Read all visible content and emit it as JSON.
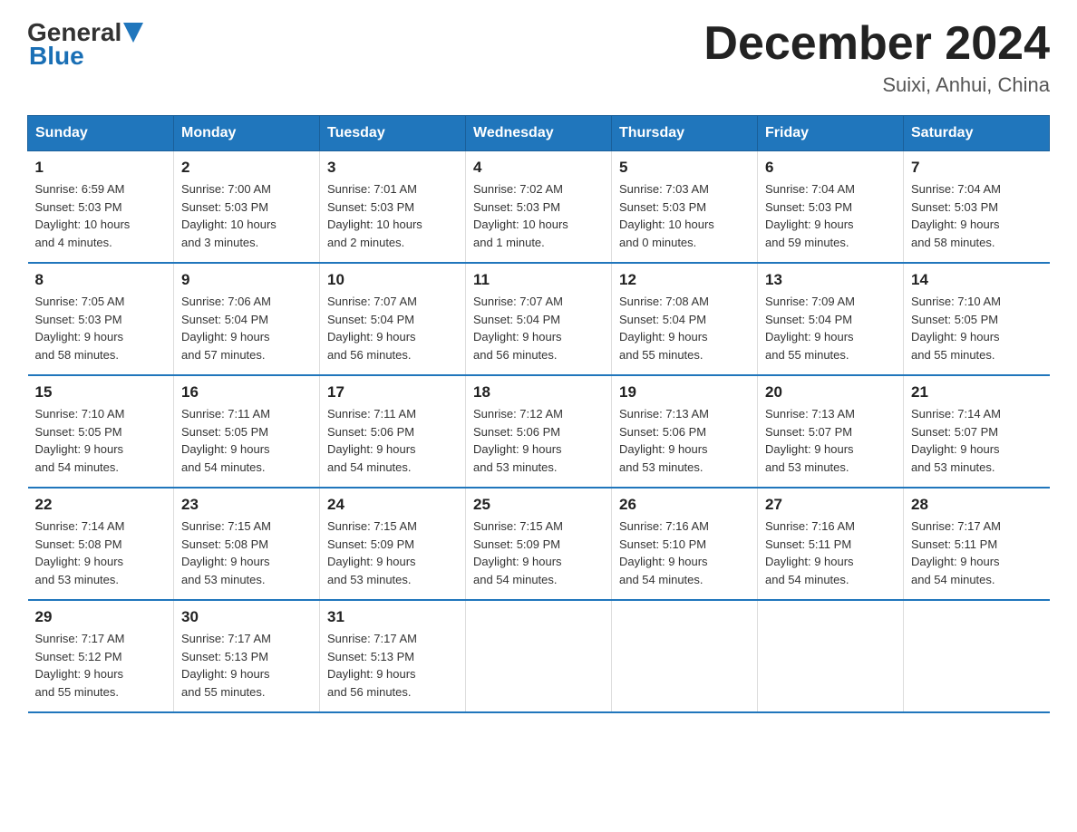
{
  "header": {
    "logo_general": "General",
    "logo_blue": "Blue",
    "month_title": "December 2024",
    "location": "Suixi, Anhui, China"
  },
  "days_of_week": [
    "Sunday",
    "Monday",
    "Tuesday",
    "Wednesday",
    "Thursday",
    "Friday",
    "Saturday"
  ],
  "weeks": [
    [
      {
        "day": "1",
        "info": "Sunrise: 6:59 AM\nSunset: 5:03 PM\nDaylight: 10 hours\nand 4 minutes."
      },
      {
        "day": "2",
        "info": "Sunrise: 7:00 AM\nSunset: 5:03 PM\nDaylight: 10 hours\nand 3 minutes."
      },
      {
        "day": "3",
        "info": "Sunrise: 7:01 AM\nSunset: 5:03 PM\nDaylight: 10 hours\nand 2 minutes."
      },
      {
        "day": "4",
        "info": "Sunrise: 7:02 AM\nSunset: 5:03 PM\nDaylight: 10 hours\nand 1 minute."
      },
      {
        "day": "5",
        "info": "Sunrise: 7:03 AM\nSunset: 5:03 PM\nDaylight: 10 hours\nand 0 minutes."
      },
      {
        "day": "6",
        "info": "Sunrise: 7:04 AM\nSunset: 5:03 PM\nDaylight: 9 hours\nand 59 minutes."
      },
      {
        "day": "7",
        "info": "Sunrise: 7:04 AM\nSunset: 5:03 PM\nDaylight: 9 hours\nand 58 minutes."
      }
    ],
    [
      {
        "day": "8",
        "info": "Sunrise: 7:05 AM\nSunset: 5:03 PM\nDaylight: 9 hours\nand 58 minutes."
      },
      {
        "day": "9",
        "info": "Sunrise: 7:06 AM\nSunset: 5:04 PM\nDaylight: 9 hours\nand 57 minutes."
      },
      {
        "day": "10",
        "info": "Sunrise: 7:07 AM\nSunset: 5:04 PM\nDaylight: 9 hours\nand 56 minutes."
      },
      {
        "day": "11",
        "info": "Sunrise: 7:07 AM\nSunset: 5:04 PM\nDaylight: 9 hours\nand 56 minutes."
      },
      {
        "day": "12",
        "info": "Sunrise: 7:08 AM\nSunset: 5:04 PM\nDaylight: 9 hours\nand 55 minutes."
      },
      {
        "day": "13",
        "info": "Sunrise: 7:09 AM\nSunset: 5:04 PM\nDaylight: 9 hours\nand 55 minutes."
      },
      {
        "day": "14",
        "info": "Sunrise: 7:10 AM\nSunset: 5:05 PM\nDaylight: 9 hours\nand 55 minutes."
      }
    ],
    [
      {
        "day": "15",
        "info": "Sunrise: 7:10 AM\nSunset: 5:05 PM\nDaylight: 9 hours\nand 54 minutes."
      },
      {
        "day": "16",
        "info": "Sunrise: 7:11 AM\nSunset: 5:05 PM\nDaylight: 9 hours\nand 54 minutes."
      },
      {
        "day": "17",
        "info": "Sunrise: 7:11 AM\nSunset: 5:06 PM\nDaylight: 9 hours\nand 54 minutes."
      },
      {
        "day": "18",
        "info": "Sunrise: 7:12 AM\nSunset: 5:06 PM\nDaylight: 9 hours\nand 53 minutes."
      },
      {
        "day": "19",
        "info": "Sunrise: 7:13 AM\nSunset: 5:06 PM\nDaylight: 9 hours\nand 53 minutes."
      },
      {
        "day": "20",
        "info": "Sunrise: 7:13 AM\nSunset: 5:07 PM\nDaylight: 9 hours\nand 53 minutes."
      },
      {
        "day": "21",
        "info": "Sunrise: 7:14 AM\nSunset: 5:07 PM\nDaylight: 9 hours\nand 53 minutes."
      }
    ],
    [
      {
        "day": "22",
        "info": "Sunrise: 7:14 AM\nSunset: 5:08 PM\nDaylight: 9 hours\nand 53 minutes."
      },
      {
        "day": "23",
        "info": "Sunrise: 7:15 AM\nSunset: 5:08 PM\nDaylight: 9 hours\nand 53 minutes."
      },
      {
        "day": "24",
        "info": "Sunrise: 7:15 AM\nSunset: 5:09 PM\nDaylight: 9 hours\nand 53 minutes."
      },
      {
        "day": "25",
        "info": "Sunrise: 7:15 AM\nSunset: 5:09 PM\nDaylight: 9 hours\nand 54 minutes."
      },
      {
        "day": "26",
        "info": "Sunrise: 7:16 AM\nSunset: 5:10 PM\nDaylight: 9 hours\nand 54 minutes."
      },
      {
        "day": "27",
        "info": "Sunrise: 7:16 AM\nSunset: 5:11 PM\nDaylight: 9 hours\nand 54 minutes."
      },
      {
        "day": "28",
        "info": "Sunrise: 7:17 AM\nSunset: 5:11 PM\nDaylight: 9 hours\nand 54 minutes."
      }
    ],
    [
      {
        "day": "29",
        "info": "Sunrise: 7:17 AM\nSunset: 5:12 PM\nDaylight: 9 hours\nand 55 minutes."
      },
      {
        "day": "30",
        "info": "Sunrise: 7:17 AM\nSunset: 5:13 PM\nDaylight: 9 hours\nand 55 minutes."
      },
      {
        "day": "31",
        "info": "Sunrise: 7:17 AM\nSunset: 5:13 PM\nDaylight: 9 hours\nand 56 minutes."
      },
      {
        "day": "",
        "info": ""
      },
      {
        "day": "",
        "info": ""
      },
      {
        "day": "",
        "info": ""
      },
      {
        "day": "",
        "info": ""
      }
    ]
  ]
}
